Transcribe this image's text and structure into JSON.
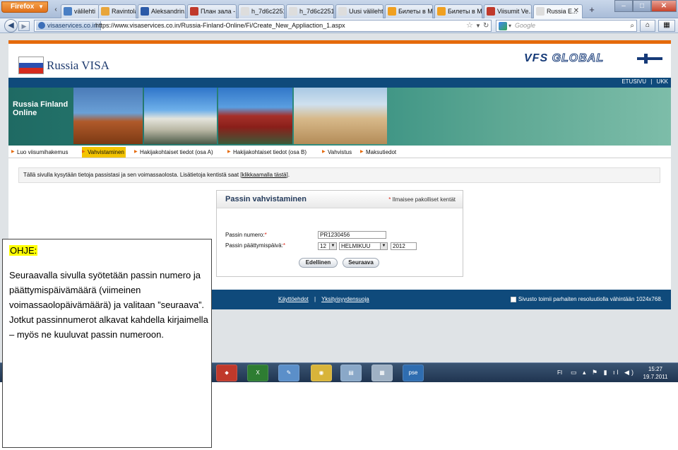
{
  "browser": {
    "firefox_label": "Firefox",
    "tabs": [
      {
        "label": "välilehti",
        "icon_color": "#4a7fc4"
      },
      {
        "label": "Ravintola C...",
        "icon_color": "#e8a53a"
      },
      {
        "label": "Aleksandrin...",
        "icon_color": "#2b5aa8"
      },
      {
        "label": "План зала -...",
        "icon_color": "#c0392b"
      },
      {
        "label": "h_7d6c2251...",
        "icon_color": "#dddddd"
      },
      {
        "label": "h_7d6c2251...",
        "icon_color": "#dddddd"
      },
      {
        "label": "Uusi välilehti",
        "icon_color": "#dddddd"
      },
      {
        "label": "Билеты в М...",
        "icon_color": "#f0a020"
      },
      {
        "label": "Билеты в М...",
        "icon_color": "#f0a020"
      },
      {
        "label": "Viisumit Ve...",
        "icon_color": "#c0392b"
      },
      {
        "label": "Russia E...",
        "icon_color": "#dddddd"
      }
    ],
    "site_identity": "visaservices.co.in",
    "url": "https://www.visaservices.co.in/Russia-Finland-Online/Fi/Create_New_Appliaction_1.aspx",
    "search_placeholder": "Google"
  },
  "site": {
    "brand": "Russia VISA",
    "vfs_logo_a": "VFS",
    "vfs_logo_b": "GLOBAL",
    "topnav": [
      "ETUSIVU",
      "|",
      "UKK"
    ],
    "banner_title_line1": "Russia Finland",
    "banner_title_line2": "Online",
    "breadcrumbs": [
      "Luo viisumihakemus",
      "Vahvistaminen",
      "Hakijakohtaiset tiedot (osa A)",
      "Hakijakohtaiset tiedot (osa B)",
      "Vahvistus",
      "Maksutiedot"
    ],
    "info_text": "Tällä sivulla kysytään tietoja passistasi ja sen voimassaolosta. Lisätietoja kentistä saat [",
    "info_link": "klikkaamalla tästä",
    "info_end": "].",
    "form": {
      "title": "Passin vahvistaminen",
      "required_note": "Ilmaisee pakolliset kentät",
      "passport_label": "Passin numero:",
      "passport_value": "PR1230456",
      "expiry_label": "Passin päättymispäivä:",
      "day_value": "12",
      "month_value": "HELMIKUU",
      "year_value": "2012",
      "prev_button": "Edellinen",
      "next_button": "Seuraava"
    },
    "footer_links": [
      "Käyttöehdot",
      "|",
      "Yksityisyydensuoja"
    ],
    "footer_note": "Sivusto toimii parhaiten resoluutiolla vähintään 1024x768."
  },
  "taskbar": {
    "lang": "FI",
    "time": "15:27",
    "date": "19.7.2011"
  },
  "instruction": {
    "title": "OHJE:",
    "text": "Seuraavalla sivulla syötetään passin numero ja päättymispäivämäärä (viimeinen voimassaolopäivämäärä) ja valitaan ”seuraava”. Jotkut passinnumerot alkavat kahdella kirjaimella – myös ne kuuluvat passin numeroon."
  }
}
